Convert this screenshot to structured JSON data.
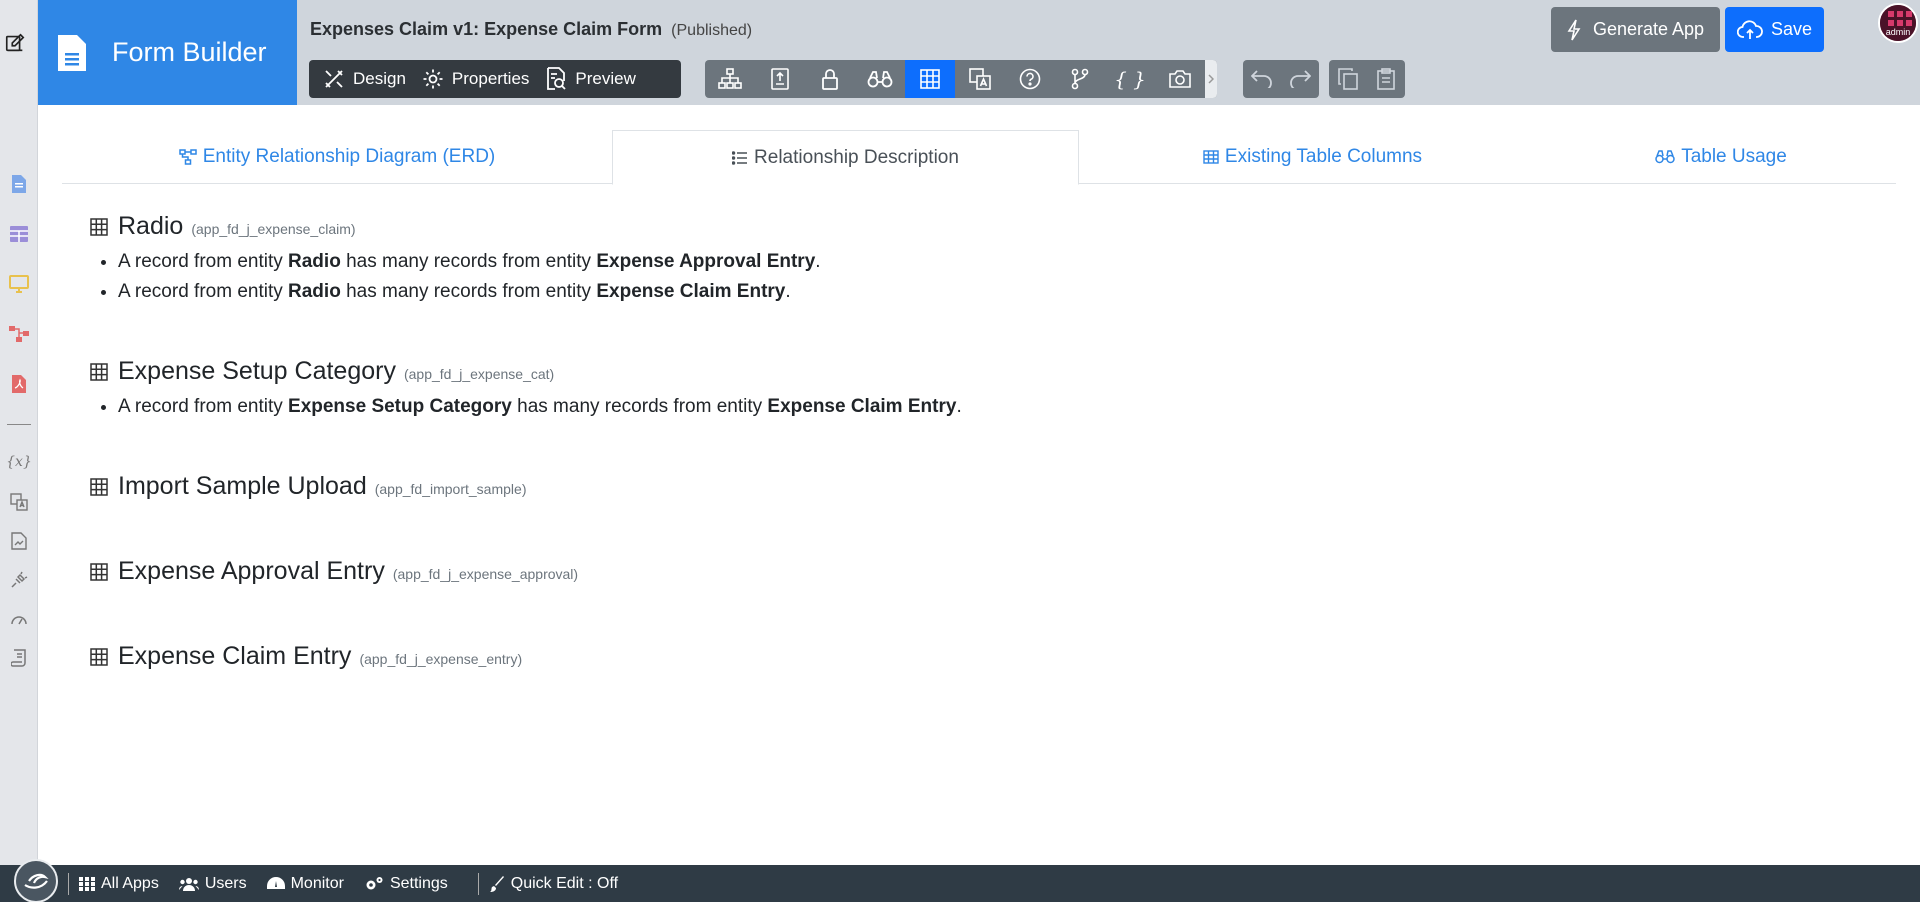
{
  "brand": {
    "title": "Form Builder"
  },
  "header": {
    "form_title": "Expenses Claim v1: Expense Claim Form",
    "form_status": "(Published)",
    "mode_buttons": [
      {
        "label": "Design",
        "icon": "design-icon"
      },
      {
        "label": "Properties",
        "icon": "gear-icon"
      },
      {
        "label": "Preview",
        "icon": "preview-icon"
      }
    ],
    "generate_label": "Generate App",
    "save_label": "Save",
    "avatar_label": "admin"
  },
  "tabs": [
    {
      "label": "Entity Relationship Diagram (ERD)",
      "icon": "erd-icon"
    },
    {
      "label": "Relationship Description",
      "icon": "list-icon",
      "active": true
    },
    {
      "label": "Existing Table Columns",
      "icon": "table-icon"
    },
    {
      "label": "Table Usage",
      "icon": "binoculars-icon"
    }
  ],
  "entities": [
    {
      "name": "Radio",
      "table": "(app_fd_j_expense_claim)",
      "relations": [
        {
          "prefix": "A record from entity ",
          "from": "Radio",
          "mid": " has many records from entity ",
          "to": "Expense Approval Entry",
          "suffix": "."
        },
        {
          "prefix": "A record from entity ",
          "from": "Radio",
          "mid": " has many records from entity ",
          "to": "Expense Claim Entry",
          "suffix": "."
        }
      ]
    },
    {
      "name": "Expense Setup Category",
      "table": "(app_fd_j_expense_cat)",
      "relations": [
        {
          "prefix": "A record from entity ",
          "from": "Expense Setup Category",
          "mid": " has many records from entity ",
          "to": "Expense Claim Entry",
          "suffix": "."
        }
      ]
    },
    {
      "name": "Import Sample Upload",
      "table": "(app_fd_import_sample)",
      "relations": []
    },
    {
      "name": "Expense Approval Entry",
      "table": "(app_fd_j_expense_approval)",
      "relations": []
    },
    {
      "name": "Expense Claim Entry",
      "table": "(app_fd_j_expense_entry)",
      "relations": []
    }
  ],
  "footer": {
    "items": [
      {
        "label": "All Apps",
        "icon": "grid-icon"
      },
      {
        "label": "Users",
        "icon": "users-icon"
      },
      {
        "label": "Monitor",
        "icon": "gauge-icon"
      },
      {
        "label": "Settings",
        "icon": "gears-icon"
      }
    ],
    "quick_edit": "Quick Edit : Off"
  },
  "colors": {
    "brand": "#2f87e6",
    "primary": "#0d6efd",
    "footer": "#2f3b45",
    "header": "#cfd5dc"
  }
}
